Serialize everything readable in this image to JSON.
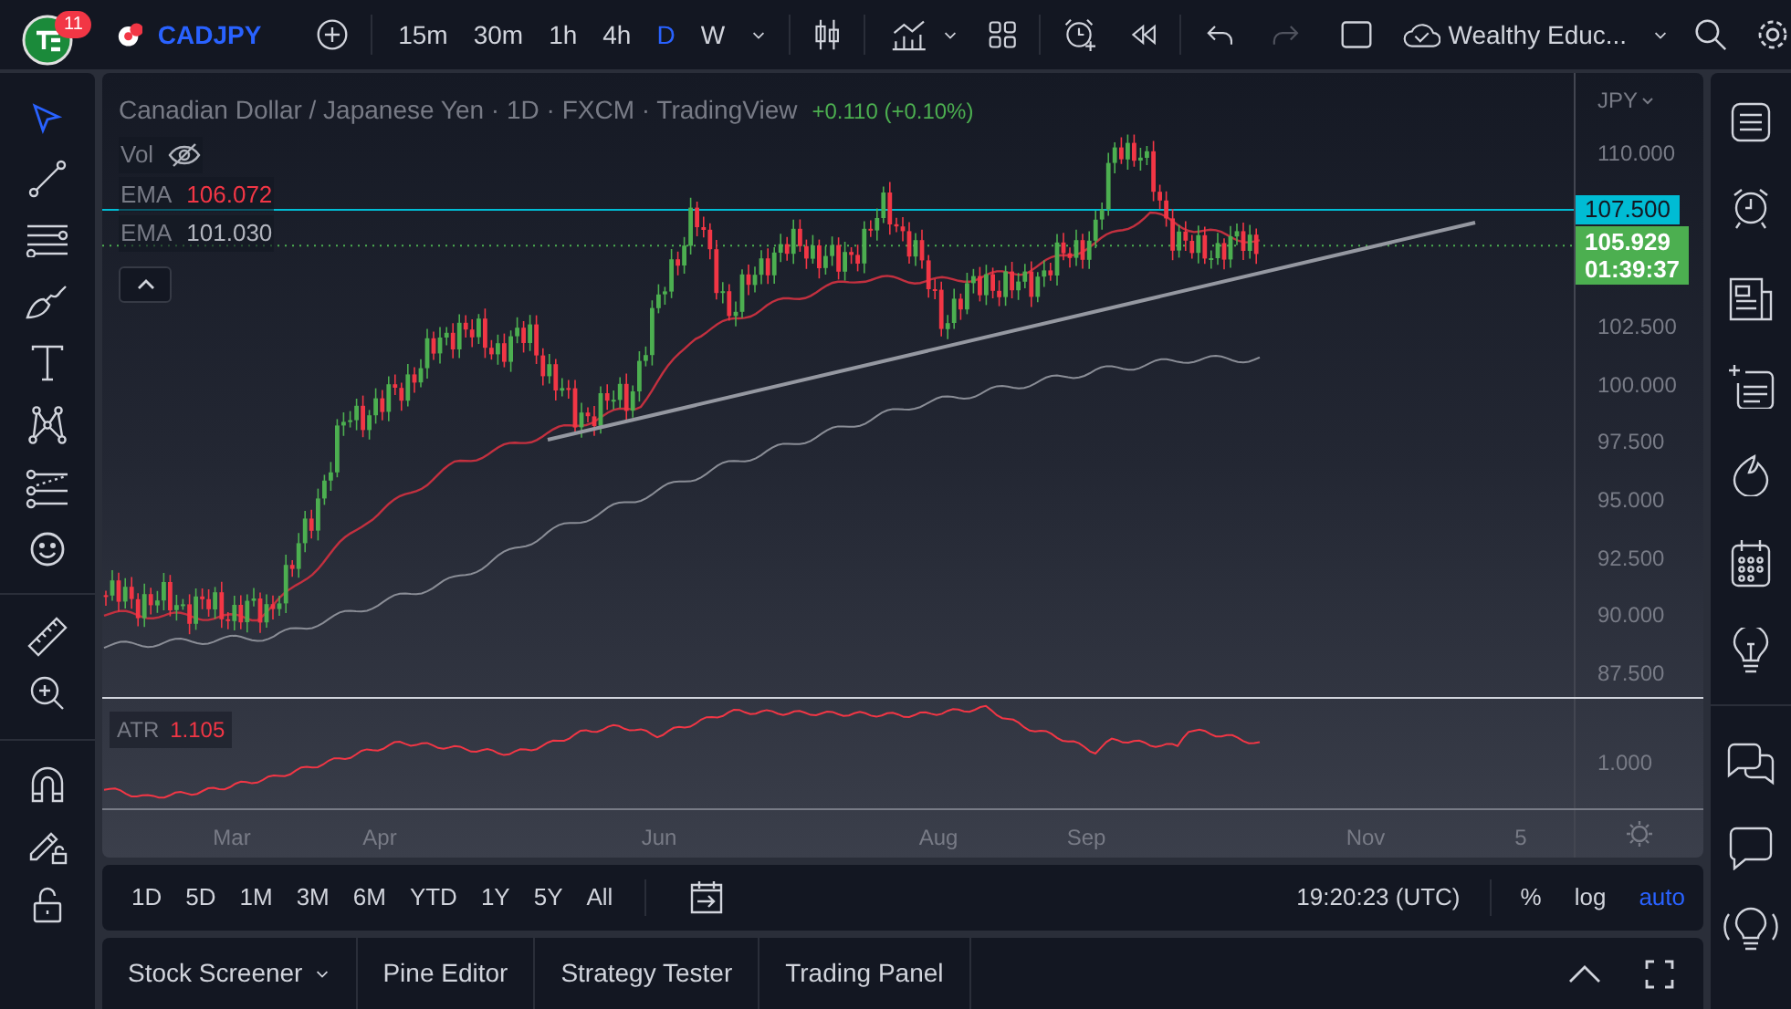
{
  "top_bar": {
    "notification_count": "11",
    "symbol": "CADJPY",
    "intervals": [
      {
        "label": "15m",
        "selected": false
      },
      {
        "label": "30m",
        "selected": false
      },
      {
        "label": "1h",
        "selected": false
      },
      {
        "label": "4h",
        "selected": false
      },
      {
        "label": "D",
        "selected": true
      },
      {
        "label": "W",
        "selected": false
      }
    ],
    "layout_name": "Wealthy Educ..."
  },
  "chart": {
    "title": "Canadian Dollar / Japanese Yen · 1D · FXCM · TradingView",
    "change": "+0.110 (+0.10%)",
    "indicators": [
      {
        "kind": "hidden",
        "name": "Vol"
      },
      {
        "kind": "value",
        "name": "EMA",
        "value": "106.072",
        "color": "#f23645"
      },
      {
        "kind": "value",
        "name": "EMA",
        "value": "101.030",
        "color": "#b2b5be"
      }
    ],
    "currency": "JPY",
    "price_ticks": [
      "110.000",
      "102.500",
      "100.000",
      "97.500",
      "95.000",
      "92.500",
      "90.000",
      "87.500"
    ],
    "level_tag": "107.500",
    "last_price": "105.929",
    "countdown": "01:39:37",
    "atr": {
      "name": "ATR",
      "value": "1.105",
      "tick": "1.000"
    },
    "time_axis": [
      "Mar",
      "Apr",
      "Jun",
      "Aug",
      "Sep",
      "Nov",
      "5"
    ]
  },
  "range_bar": {
    "ranges": [
      "1D",
      "5D",
      "1M",
      "3M",
      "6M",
      "YTD",
      "1Y",
      "5Y",
      "All"
    ],
    "time": "19:20:23 (UTC)",
    "scale_options": [
      {
        "label": "%",
        "selected": false
      },
      {
        "label": "log",
        "selected": false
      },
      {
        "label": "auto",
        "selected": true
      }
    ]
  },
  "bottom_panel": {
    "tabs": [
      {
        "label": "Stock Screener",
        "dropdown": true
      },
      {
        "label": "Pine Editor",
        "dropdown": false
      },
      {
        "label": "Strategy Tester",
        "dropdown": false
      },
      {
        "label": "Trading Panel",
        "dropdown": false
      }
    ]
  }
}
